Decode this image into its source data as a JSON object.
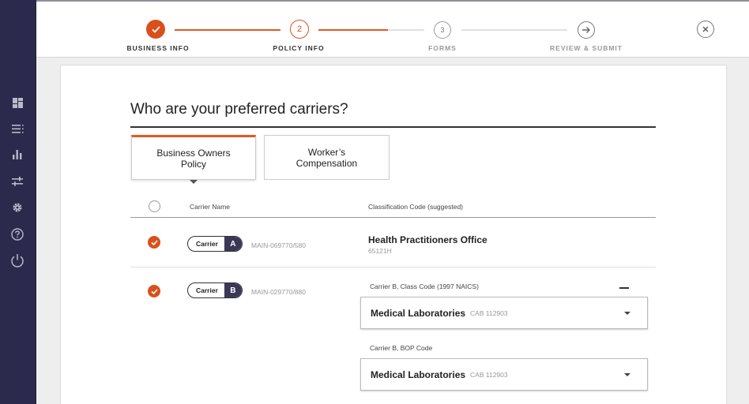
{
  "sidebar": {
    "items": [
      {
        "icon": "dashboard-icon"
      },
      {
        "icon": "list-icon"
      },
      {
        "icon": "bar-chart-icon"
      },
      {
        "icon": "sliders-icon"
      },
      {
        "icon": "gear-icon"
      },
      {
        "icon": "help-icon"
      },
      {
        "icon": "power-icon"
      }
    ]
  },
  "stepper": {
    "steps": [
      {
        "label": "BUSINESS INFO",
        "marker": "",
        "state": "done"
      },
      {
        "label": "POLICY INFO",
        "marker": "2",
        "state": "current"
      },
      {
        "label": "FORMS",
        "marker": "3",
        "state": "upcoming"
      },
      {
        "label": "REVIEW & SUBMIT",
        "marker": "",
        "state": "upcoming"
      }
    ],
    "progress_into_current_segment": 0.66
  },
  "page": {
    "heading": "Who are your preferred carriers?"
  },
  "tabs": [
    {
      "label": "Business Owners Policy",
      "active": true
    },
    {
      "label": "Worker’s Compensation",
      "active": false
    }
  ],
  "table": {
    "headers": {
      "carrier": "Carrier Name",
      "classification": "Classification Code (suggested)"
    },
    "rows": [
      {
        "checked": true,
        "carrier_text": "Carrier",
        "carrier_letter": "A",
        "code": "MAIN-069770/580",
        "class_title": "Health Practitioners Office",
        "class_sub": "65121H"
      },
      {
        "checked": true,
        "carrier_text": "Carrier",
        "carrier_letter": "B",
        "code": "MAIN-029770/880",
        "fields": [
          {
            "label": "Carrier B, Class Code (1997 NAICS)",
            "value": "Medical Laboratories",
            "code": "CAB 112903"
          },
          {
            "label": "Carrier B, BOP Code",
            "value": "Medical Laboratories",
            "code": "CAB 112903"
          }
        ]
      }
    ]
  },
  "colors": {
    "accent": "#d9501c",
    "sidebar": "#2b2a4c",
    "pill_dark": "#3b3756"
  }
}
